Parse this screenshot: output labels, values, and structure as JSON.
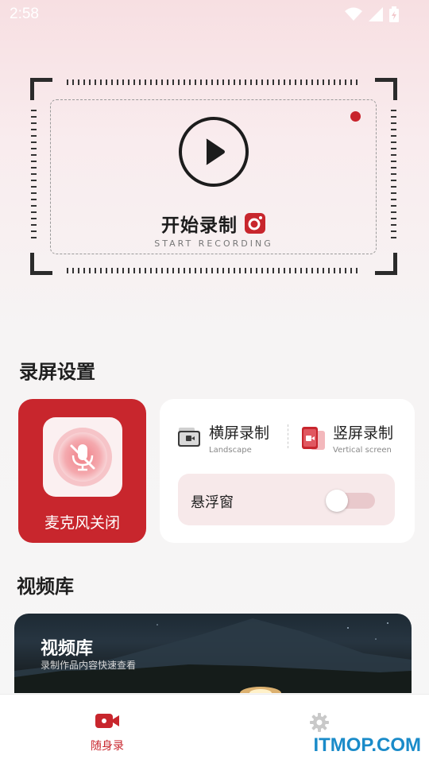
{
  "status_bar": {
    "time": "2:58"
  },
  "recorder": {
    "title": "开始录制",
    "subtitle": "START RECORDING"
  },
  "screen_settings": {
    "section_title": "录屏设置",
    "mic": {
      "label": "麦克风关闭"
    },
    "landscape": {
      "title": "横屏录制",
      "subtitle": "Landscape"
    },
    "vertical": {
      "title": "竖屏录制",
      "subtitle": "Vertical screen"
    },
    "floating_window": {
      "label": "悬浮窗",
      "enabled": false
    }
  },
  "video_library": {
    "section_title": "视频库",
    "banner_title": "视频库",
    "banner_subtitle": "录制作品内容快速查看"
  },
  "bottom_nav": {
    "items": [
      {
        "label": "随身录",
        "icon": "video-camera-icon",
        "active": true
      },
      {
        "label": "",
        "icon": "gear-icon",
        "active": false
      }
    ]
  },
  "watermark": "ITMOP.COM",
  "colors": {
    "accent": "#c8262d",
    "toggle_off_track": "#e9c9cc",
    "watermark": "#1a8bc9"
  }
}
